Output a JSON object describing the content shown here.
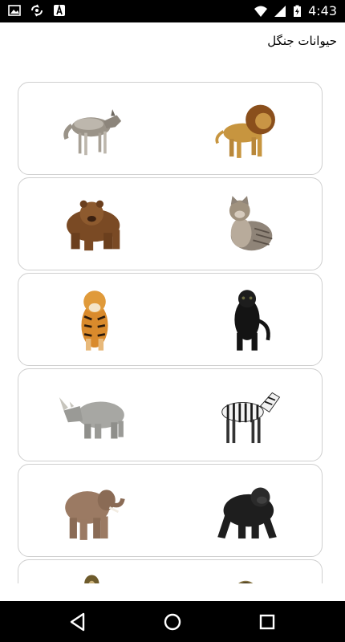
{
  "status_bar": {
    "time": "4:43",
    "left_icons": [
      "image-icon",
      "sync-icon",
      "app-a-icon"
    ],
    "right_icons": [
      "wifi-icon",
      "signal-icon",
      "battery-charging-icon"
    ]
  },
  "header": {
    "title": "حیوانات جنگل"
  },
  "cards": [
    {
      "left": "wolf",
      "right": "lion"
    },
    {
      "left": "brown-bear",
      "right": "wildcat"
    },
    {
      "left": "tiger",
      "right": "black-panther"
    },
    {
      "left": "rhinoceros",
      "right": "zebra"
    },
    {
      "left": "elephant",
      "right": "gorilla"
    },
    {
      "left": "cobra",
      "right": "snake"
    }
  ],
  "navigation": {
    "buttons": [
      "back-icon",
      "home-icon",
      "recents-icon"
    ]
  },
  "colors": {
    "status_bar": "#000000",
    "nav_bar": "#000000",
    "card_border": "#cfcfcf",
    "background": "#ffffff"
  }
}
